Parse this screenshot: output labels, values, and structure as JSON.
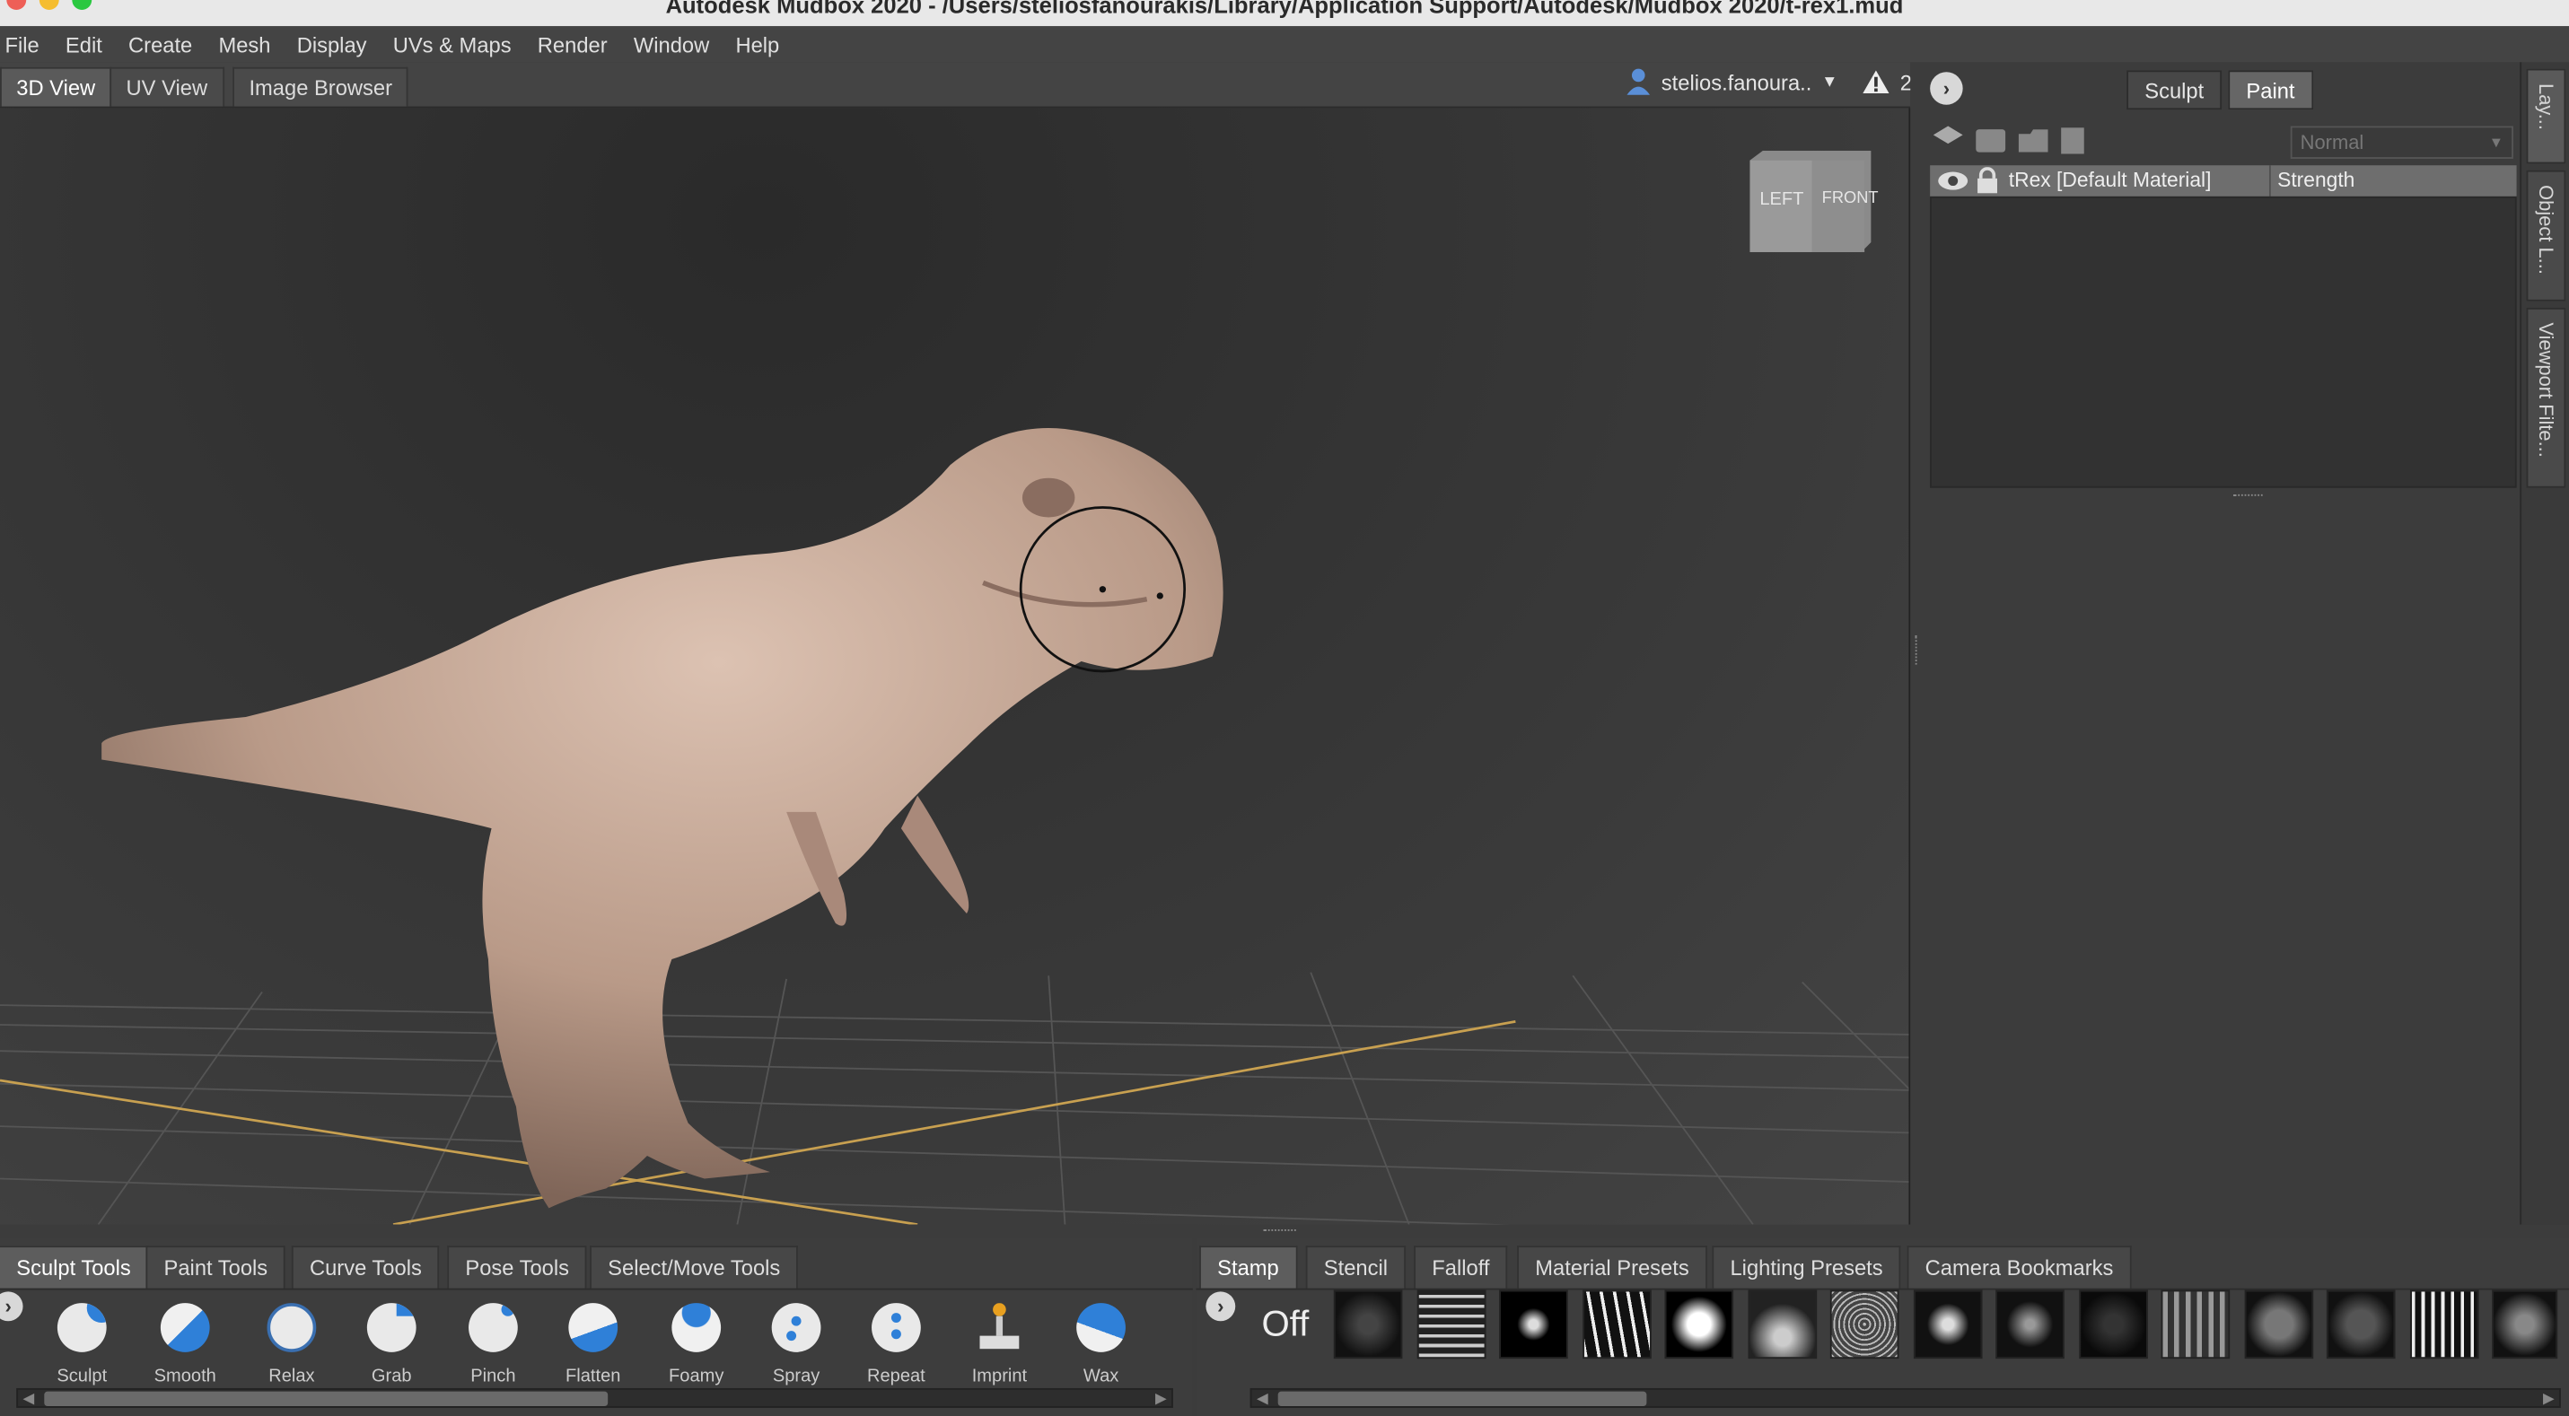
{
  "window": {
    "title": "Autodesk Mudbox 2020 - /Users/steliosfanourakis/Library/Application Support/Autodesk/Mudbox 2020/t-rex1.mud"
  },
  "menu": [
    "File",
    "Edit",
    "Create",
    "Mesh",
    "Display",
    "UVs & Maps",
    "Render",
    "Window",
    "Help"
  ],
  "view_tabs": [
    "3D View",
    "UV View",
    "Image Browser"
  ],
  "user": {
    "name": "stelios.fanoura..",
    "alert_count": "2"
  },
  "viewcube": {
    "left": "LEFT",
    "front": "FRONT"
  },
  "mode_tabs": {
    "sculpt": "Sculpt",
    "paint": "Paint"
  },
  "layers": {
    "blend_mode": "Normal",
    "row_name": "tRex [Default Material]",
    "row_value": "Strength"
  },
  "side_tabs": [
    "Lay...",
    "Object L...",
    "Viewport Filte..."
  ],
  "tool_tabs": [
    "Sculpt Tools",
    "Paint Tools",
    "Curve Tools",
    "Pose Tools",
    "Select/Move Tools"
  ],
  "tools": [
    "Sculpt",
    "Smooth",
    "Relax",
    "Grab",
    "Pinch",
    "Flatten",
    "Foamy",
    "Spray",
    "Repeat",
    "Imprint",
    "Wax"
  ],
  "tray_tabs": [
    "Stamp",
    "Stencil",
    "Falloff",
    "Material Presets",
    "Lighting Presets",
    "Camera Bookmarks"
  ],
  "stamp_off": "Off",
  "colors": {
    "accent_orange": "#c8a050",
    "model": "#c4a493",
    "grid": "#555555"
  }
}
